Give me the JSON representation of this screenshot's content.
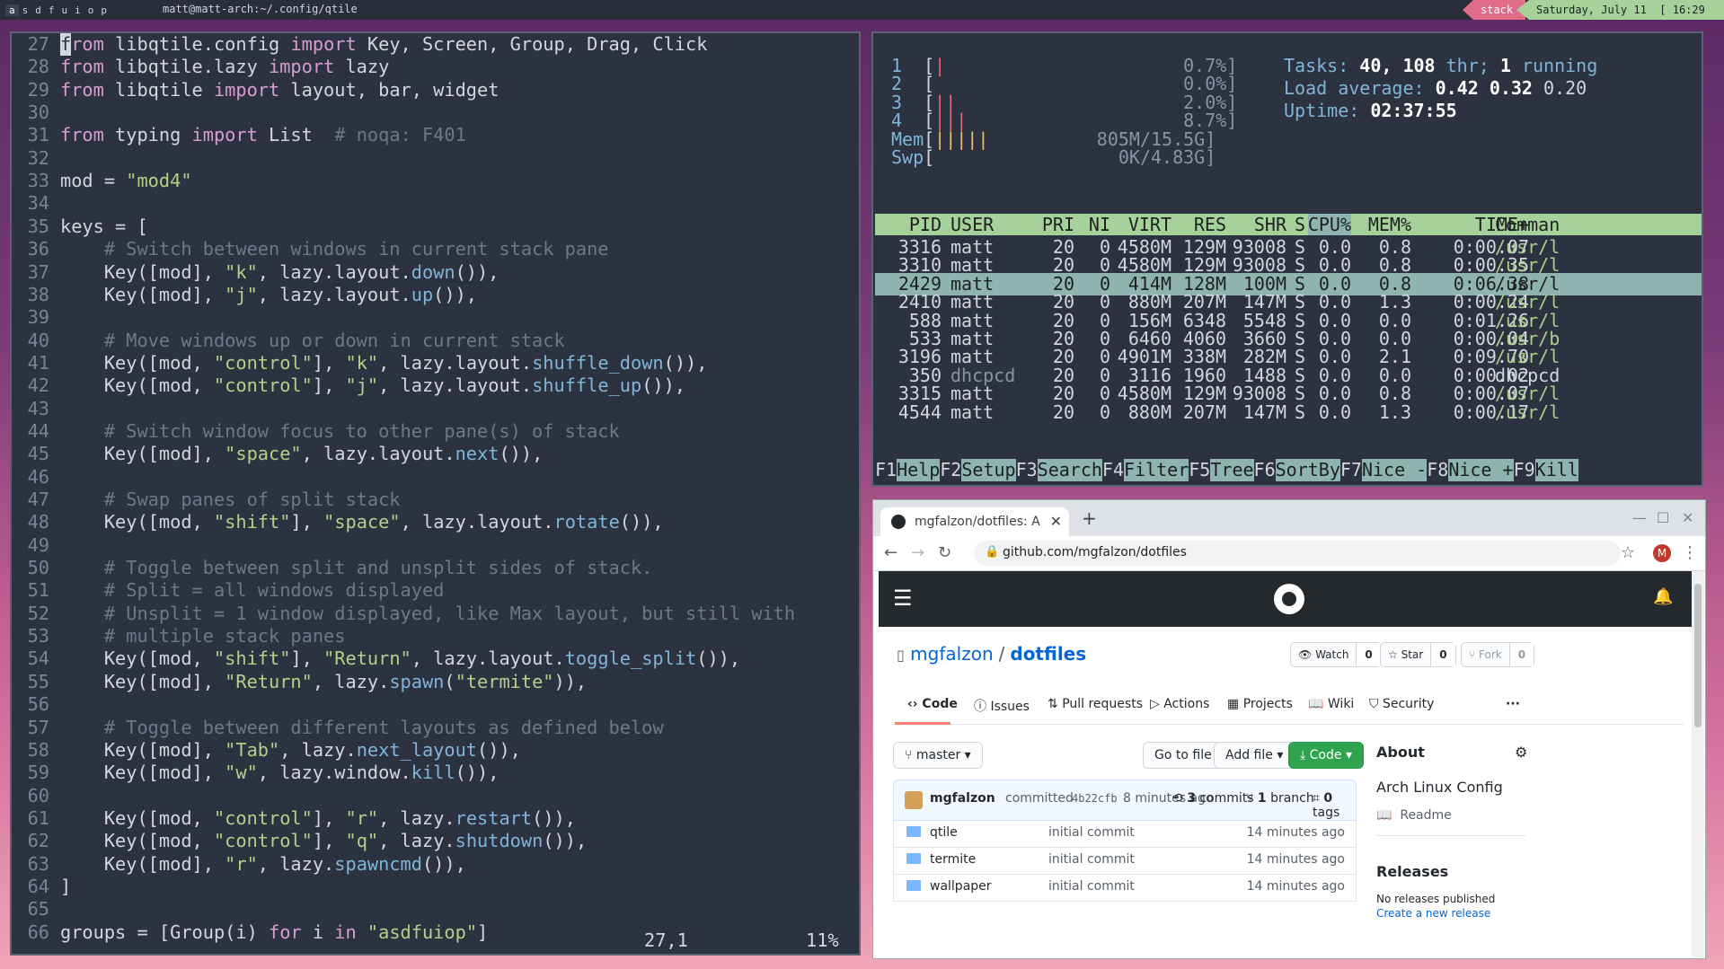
{
  "topbar": {
    "groups": [
      "a",
      "s",
      "d",
      "f",
      "u",
      "i",
      "o",
      "p"
    ],
    "window_title": "matt@matt-arch:~/.config/qtile",
    "layout": "stack",
    "date": "Saturday, July 11",
    "time": "[ 16:29 ]"
  },
  "editor": {
    "lines": [
      {
        "n": "27",
        "segs": [
          [
            "kw",
            "from"
          ],
          [
            "t",
            " libqtile.config "
          ],
          [
            "kw",
            "import"
          ],
          [
            "t",
            " Key, Screen, Group, Drag, Click"
          ]
        ]
      },
      {
        "n": "28",
        "segs": [
          [
            "kw",
            "from"
          ],
          [
            "t",
            " libqtile.lazy "
          ],
          [
            "kw",
            "import"
          ],
          [
            "t",
            " lazy"
          ]
        ]
      },
      {
        "n": "29",
        "segs": [
          [
            "kw",
            "from"
          ],
          [
            "t",
            " libqtile "
          ],
          [
            "kw",
            "import"
          ],
          [
            "t",
            " layout, bar, widget"
          ]
        ]
      },
      {
        "n": "30",
        "segs": []
      },
      {
        "n": "31",
        "segs": [
          [
            "kw",
            "from"
          ],
          [
            "t",
            " typing "
          ],
          [
            "kw",
            "import"
          ],
          [
            "t",
            " List  "
          ],
          [
            "cmt",
            "# noqa: F401"
          ]
        ]
      },
      {
        "n": "32",
        "segs": []
      },
      {
        "n": "33",
        "segs": [
          [
            "t",
            "mod = "
          ],
          [
            "str",
            "\"mod4\""
          ]
        ]
      },
      {
        "n": "34",
        "segs": []
      },
      {
        "n": "35",
        "segs": [
          [
            "t",
            "keys = ["
          ]
        ]
      },
      {
        "n": "36",
        "segs": [
          [
            "cmt",
            "    # Switch between windows in current stack pane"
          ]
        ]
      },
      {
        "n": "37",
        "segs": [
          [
            "t",
            "    Key([mod], "
          ],
          [
            "str",
            "\"k\""
          ],
          [
            "t",
            ", lazy.layout."
          ],
          [
            "fn",
            "down"
          ],
          [
            "t",
            "()),"
          ]
        ]
      },
      {
        "n": "38",
        "segs": [
          [
            "t",
            "    Key([mod], "
          ],
          [
            "str",
            "\"j\""
          ],
          [
            "t",
            ", lazy.layout."
          ],
          [
            "fn",
            "up"
          ],
          [
            "t",
            "()),"
          ]
        ]
      },
      {
        "n": "39",
        "segs": []
      },
      {
        "n": "40",
        "segs": [
          [
            "cmt",
            "    # Move windows up or down in current stack"
          ]
        ]
      },
      {
        "n": "41",
        "segs": [
          [
            "t",
            "    Key([mod, "
          ],
          [
            "str",
            "\"control\""
          ],
          [
            "t",
            "], "
          ],
          [
            "str",
            "\"k\""
          ],
          [
            "t",
            ", lazy.layout."
          ],
          [
            "fn",
            "shuffle_down"
          ],
          [
            "t",
            "()),"
          ]
        ]
      },
      {
        "n": "42",
        "segs": [
          [
            "t",
            "    Key([mod, "
          ],
          [
            "str",
            "\"control\""
          ],
          [
            "t",
            "], "
          ],
          [
            "str",
            "\"j\""
          ],
          [
            "t",
            ", lazy.layout."
          ],
          [
            "fn",
            "shuffle_up"
          ],
          [
            "t",
            "()),"
          ]
        ]
      },
      {
        "n": "43",
        "segs": []
      },
      {
        "n": "44",
        "segs": [
          [
            "cmt",
            "    # Switch window focus to other pane(s) of stack"
          ]
        ]
      },
      {
        "n": "45",
        "segs": [
          [
            "t",
            "    Key([mod], "
          ],
          [
            "str",
            "\"space\""
          ],
          [
            "t",
            ", lazy.layout."
          ],
          [
            "fn",
            "next"
          ],
          [
            "t",
            "()),"
          ]
        ]
      },
      {
        "n": "46",
        "segs": []
      },
      {
        "n": "47",
        "segs": [
          [
            "cmt",
            "    # Swap panes of split stack"
          ]
        ]
      },
      {
        "n": "48",
        "segs": [
          [
            "t",
            "    Key([mod, "
          ],
          [
            "str",
            "\"shift\""
          ],
          [
            "t",
            "], "
          ],
          [
            "str",
            "\"space\""
          ],
          [
            "t",
            ", lazy.layout."
          ],
          [
            "fn",
            "rotate"
          ],
          [
            "t",
            "()),"
          ]
        ]
      },
      {
        "n": "49",
        "segs": []
      },
      {
        "n": "50",
        "segs": [
          [
            "cmt",
            "    # Toggle between split and unsplit sides of stack."
          ]
        ]
      },
      {
        "n": "51",
        "segs": [
          [
            "cmt",
            "    # Split = all windows displayed"
          ]
        ]
      },
      {
        "n": "52",
        "segs": [
          [
            "cmt",
            "    # Unsplit = 1 window displayed, like Max layout, but still with"
          ]
        ]
      },
      {
        "n": "53",
        "segs": [
          [
            "cmt",
            "    # multiple stack panes"
          ]
        ]
      },
      {
        "n": "54",
        "segs": [
          [
            "t",
            "    Key([mod, "
          ],
          [
            "str",
            "\"shift\""
          ],
          [
            "t",
            "], "
          ],
          [
            "str",
            "\"Return\""
          ],
          [
            "t",
            ", lazy.layout."
          ],
          [
            "fn",
            "toggle_split"
          ],
          [
            "t",
            "()),"
          ]
        ]
      },
      {
        "n": "55",
        "segs": [
          [
            "t",
            "    Key([mod], "
          ],
          [
            "str",
            "\"Return\""
          ],
          [
            "t",
            ", lazy."
          ],
          [
            "fn",
            "spawn"
          ],
          [
            "t",
            "("
          ],
          [
            "str",
            "\"termite\""
          ],
          [
            "t",
            ")),"
          ]
        ]
      },
      {
        "n": "56",
        "segs": []
      },
      {
        "n": "57",
        "segs": [
          [
            "cmt",
            "    # Toggle between different layouts as defined below"
          ]
        ]
      },
      {
        "n": "58",
        "segs": [
          [
            "t",
            "    Key([mod], "
          ],
          [
            "str",
            "\"Tab\""
          ],
          [
            "t",
            ", lazy."
          ],
          [
            "fn",
            "next_layout"
          ],
          [
            "t",
            "()),"
          ]
        ]
      },
      {
        "n": "59",
        "segs": [
          [
            "t",
            "    Key([mod], "
          ],
          [
            "str",
            "\"w\""
          ],
          [
            "t",
            ", lazy.window."
          ],
          [
            "fn",
            "kill"
          ],
          [
            "t",
            "()),"
          ]
        ]
      },
      {
        "n": "60",
        "segs": []
      },
      {
        "n": "61",
        "segs": [
          [
            "t",
            "    Key([mod, "
          ],
          [
            "str",
            "\"control\""
          ],
          [
            "t",
            "], "
          ],
          [
            "str",
            "\"r\""
          ],
          [
            "t",
            ", lazy."
          ],
          [
            "fn",
            "restart"
          ],
          [
            "t",
            "()),"
          ]
        ]
      },
      {
        "n": "62",
        "segs": [
          [
            "t",
            "    Key([mod, "
          ],
          [
            "str",
            "\"control\""
          ],
          [
            "t",
            "], "
          ],
          [
            "str",
            "\"q\""
          ],
          [
            "t",
            ", lazy."
          ],
          [
            "fn",
            "shutdown"
          ],
          [
            "t",
            "()),"
          ]
        ]
      },
      {
        "n": "63",
        "segs": [
          [
            "t",
            "    Key([mod], "
          ],
          [
            "str",
            "\"r\""
          ],
          [
            "t",
            ", lazy."
          ],
          [
            "fn",
            "spawncmd"
          ],
          [
            "t",
            "()),"
          ]
        ]
      },
      {
        "n": "64",
        "segs": [
          [
            "t",
            "]"
          ]
        ]
      },
      {
        "n": "65",
        "segs": []
      },
      {
        "n": "66",
        "segs": [
          [
            "t",
            "groups = [Group(i) "
          ],
          [
            "kw",
            "for"
          ],
          [
            "t",
            " i "
          ],
          [
            "kw",
            "in"
          ],
          [
            "t",
            " "
          ],
          [
            "str",
            "\"asdfuiop\""
          ],
          [
            "t",
            "]"
          ]
        ]
      }
    ],
    "position": "27,1",
    "percent": "11%"
  },
  "htop": {
    "cpus": [
      {
        "n": "1",
        "bars": "|",
        "pct": "0.7%]"
      },
      {
        "n": "2",
        "bars": "",
        "pct": "0.0%]"
      },
      {
        "n": "3",
        "bars": "||",
        "pct": "2.0%]"
      },
      {
        "n": "4",
        "bars": "|||",
        "pct": "8.7%]"
      }
    ],
    "mem": {
      "label": "Mem",
      "bars": "|||||",
      "val": "805M/15.5G]"
    },
    "swp": {
      "label": "Swp",
      "bars": "",
      "val": "0K/4.83G]"
    },
    "tasks_label": "Tasks:",
    "tasks": "40,",
    "thr": "108",
    "thr_label": "thr;",
    "running": "1",
    "running_label": "running",
    "load_label": "Load average:",
    "load1": "0.42",
    "load5": "0.32",
    "load15": "0.20",
    "uptime_label": "Uptime:",
    "uptime": "02:37:55",
    "columns": [
      "PID",
      "USER",
      "PRI",
      "NI",
      "VIRT",
      "RES",
      "SHR",
      "S",
      "CPU%",
      "MEM%",
      "TIME+",
      "Comman"
    ],
    "rows": [
      [
        "3316",
        "matt",
        "20",
        "0",
        "4580M",
        "129M",
        "93008",
        "S",
        "0.0",
        "0.8",
        "0:00.07",
        "/usr/l"
      ],
      [
        "3310",
        "matt",
        "20",
        "0",
        "4580M",
        "129M",
        "93008",
        "S",
        "0.0",
        "0.8",
        "0:00.35",
        "/usr/l"
      ],
      [
        "2429",
        "matt",
        "20",
        "0",
        "414M",
        "128M",
        "100M",
        "S",
        "0.0",
        "0.8",
        "0:06.38",
        "/usr/l"
      ],
      [
        "2410",
        "matt",
        "20",
        "0",
        "880M",
        "207M",
        "147M",
        "S",
        "0.0",
        "1.3",
        "0:00.24",
        "/usr/l"
      ],
      [
        "588",
        "matt",
        "20",
        "0",
        "156M",
        "6348",
        "5548",
        "S",
        "0.0",
        "0.0",
        "0:01.26",
        "/usr/l"
      ],
      [
        "533",
        "matt",
        "20",
        "0",
        "6460",
        "4060",
        "3660",
        "S",
        "0.0",
        "0.0",
        "0:00.04",
        "/usr/b"
      ],
      [
        "3196",
        "matt",
        "20",
        "0",
        "4901M",
        "338M",
        "282M",
        "S",
        "0.0",
        "2.1",
        "0:09.70",
        "/usr/l"
      ],
      [
        "350",
        "dhcpcd",
        "20",
        "0",
        "3116",
        "1960",
        "1488",
        "S",
        "0.0",
        "0.0",
        "0:00.02",
        "dhcpcd"
      ],
      [
        "3315",
        "matt",
        "20",
        "0",
        "4580M",
        "129M",
        "93008",
        "S",
        "0.0",
        "0.8",
        "0:00.07",
        "/usr/l"
      ],
      [
        "4544",
        "matt",
        "20",
        "0",
        "880M",
        "207M",
        "147M",
        "S",
        "0.0",
        "1.3",
        "0:00.17",
        "/usr/l"
      ]
    ],
    "selected_row": 2,
    "fkeys": [
      [
        "F1",
        "Help  "
      ],
      [
        "F2",
        "Setup "
      ],
      [
        "F3",
        "Search"
      ],
      [
        "F4",
        "Filter"
      ],
      [
        "F5",
        "Tree  "
      ],
      [
        "F6",
        "SortBy"
      ],
      [
        "F7",
        "Nice -"
      ],
      [
        "F8",
        "Nice +"
      ],
      [
        "F9",
        "Kill  "
      ]
    ]
  },
  "browser": {
    "tab_title": "mgfalzon/dotfiles: Arch Li",
    "url": "github.com/mgfalzon/dotfiles",
    "avatar": "M",
    "owner": "mgfalzon",
    "sep": "/",
    "repo": "dotfiles",
    "watch": "Watch",
    "watch_n": "0",
    "star": "Star",
    "star_n": "0",
    "fork": "Fork",
    "fork_n": "0",
    "tabs": [
      "Code",
      "Issues",
      "Pull requests",
      "Actions",
      "Projects",
      "Wiki",
      "Security"
    ],
    "branch": "master",
    "goto": "Go to file",
    "addfile": "Add file",
    "code_btn": "Code",
    "commit_author": "mgfalzon",
    "commit_word": "committed",
    "commit_hash": "4b22cfb",
    "commit_time": "8 minutes ago",
    "commits": "3",
    "commits_label": "commits",
    "branches": "1",
    "branches_label": "branch",
    "tags": "0",
    "tags_label": "tags",
    "files": [
      {
        "name": "qtile",
        "msg": "initial commit",
        "time": "14 minutes ago"
      },
      {
        "name": "termite",
        "msg": "initial commit",
        "time": "14 minutes ago"
      },
      {
        "name": "wallpaper",
        "msg": "initial commit",
        "time": "14 minutes ago"
      }
    ],
    "about_title": "About",
    "about_desc": "Arch Linux Config",
    "readme": "Readme",
    "releases_title": "Releases",
    "no_releases": "No releases published",
    "create_release": "Create a new release"
  }
}
